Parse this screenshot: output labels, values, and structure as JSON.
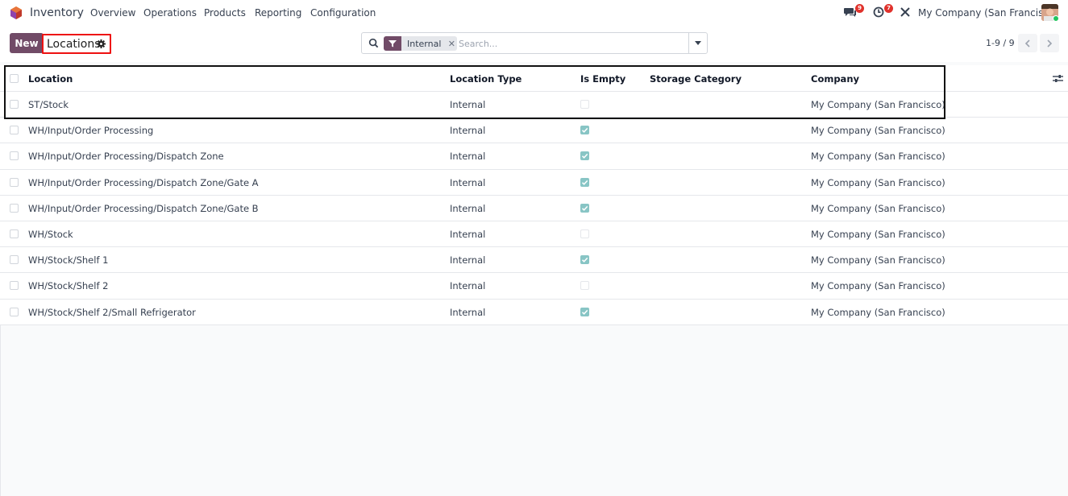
{
  "navbar": {
    "app_name": "Inventory",
    "menu": [
      "Overview",
      "Operations",
      "Products",
      "Reporting",
      "Configuration"
    ],
    "messages_count": "9",
    "activities_count": "7",
    "company": "My Company (San Francisco)"
  },
  "control": {
    "new_label": "New",
    "breadcrumb": "Locations",
    "facet_label": "Internal",
    "search_placeholder": "Search...",
    "pager": "1-9 / 9"
  },
  "table": {
    "headers": {
      "location": "Location",
      "location_type": "Location Type",
      "is_empty": "Is Empty",
      "storage_category": "Storage Category",
      "company": "Company"
    },
    "rows": [
      {
        "location": "ST/Stock",
        "type": "Internal",
        "is_empty": false,
        "storage_category": "",
        "company": "My Company (San Francisco)"
      },
      {
        "location": "WH/Input/Order Processing",
        "type": "Internal",
        "is_empty": true,
        "storage_category": "",
        "company": "My Company (San Francisco)"
      },
      {
        "location": "WH/Input/Order Processing/Dispatch Zone",
        "type": "Internal",
        "is_empty": true,
        "storage_category": "",
        "company": "My Company (San Francisco)"
      },
      {
        "location": "WH/Input/Order Processing/Dispatch Zone/Gate A",
        "type": "Internal",
        "is_empty": true,
        "storage_category": "",
        "company": "My Company (San Francisco)"
      },
      {
        "location": "WH/Input/Order Processing/Dispatch Zone/Gate B",
        "type": "Internal",
        "is_empty": true,
        "storage_category": "",
        "company": "My Company (San Francisco)"
      },
      {
        "location": "WH/Stock",
        "type": "Internal",
        "is_empty": false,
        "storage_category": "",
        "company": "My Company (San Francisco)"
      },
      {
        "location": "WH/Stock/Shelf 1",
        "type": "Internal",
        "is_empty": true,
        "storage_category": "",
        "company": "My Company (San Francisco)"
      },
      {
        "location": "WH/Stock/Shelf 2",
        "type": "Internal",
        "is_empty": false,
        "storage_category": "",
        "company": "My Company (San Francisco)"
      },
      {
        "location": "WH/Stock/Shelf 2/Small Refrigerator",
        "type": "Internal",
        "is_empty": true,
        "storage_category": "",
        "company": "My Company (San Francisco)"
      }
    ]
  },
  "colors": {
    "brand": "#714b67",
    "badge": "#e0322c",
    "checked": "#88c5c5",
    "highlight_red": "#e11111",
    "highlight_black": "#111111"
  }
}
